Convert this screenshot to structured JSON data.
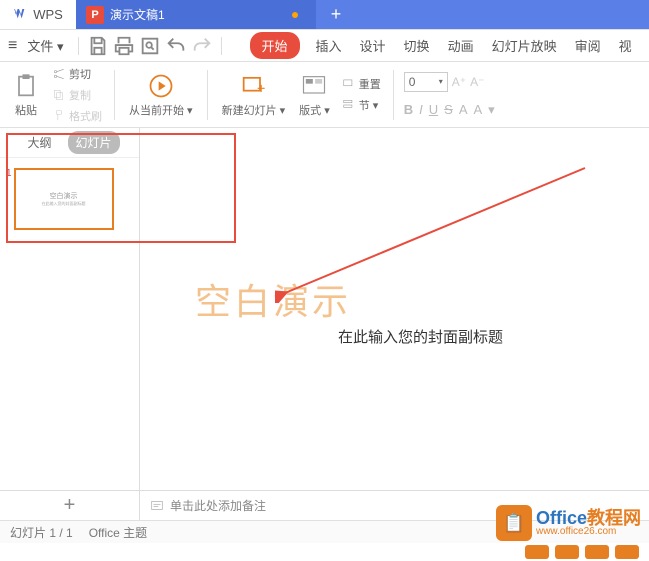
{
  "titlebar": {
    "app": "WPS",
    "doc_name": "演示文稿1",
    "doc_icon_letter": "P",
    "new_tab": "+"
  },
  "menubar": {
    "file": "文件",
    "tabs": {
      "start": "开始",
      "insert": "插入",
      "design": "设计",
      "transition": "切换",
      "animation": "动画",
      "slideshow": "幻灯片放映",
      "review": "审阅",
      "view": "视"
    }
  },
  "ribbon": {
    "paste": "粘贴",
    "cut": "剪切",
    "copy": "复制",
    "format_painter": "格式刷",
    "from_current": "从当前开始",
    "new_slide": "新建幻灯片",
    "layout": "版式",
    "section": "节",
    "reset": "重置",
    "font_size": "0",
    "increase_font": "A⁺",
    "decrease_font": "A⁻",
    "bold": "B",
    "italic": "I",
    "underline": "U",
    "strike": "S",
    "fontcolor": "A",
    "highlight": "A"
  },
  "side": {
    "outline": "大纲",
    "slides": "幻灯片",
    "slide_num": "1",
    "thumb_title": "空白演示",
    "thumb_sub": "在此输入您的封面副标题"
  },
  "canvas": {
    "title": "空白演示",
    "subtitle": "在此输入您的封面副标题"
  },
  "notes": {
    "placeholder": "单击此处添加备注"
  },
  "status": {
    "slide_counter": "幻灯片 1 / 1",
    "theme": "Office 主题"
  },
  "watermark": {
    "text": "Office教程网",
    "url": "www.office26.com"
  },
  "add_btn": "+"
}
